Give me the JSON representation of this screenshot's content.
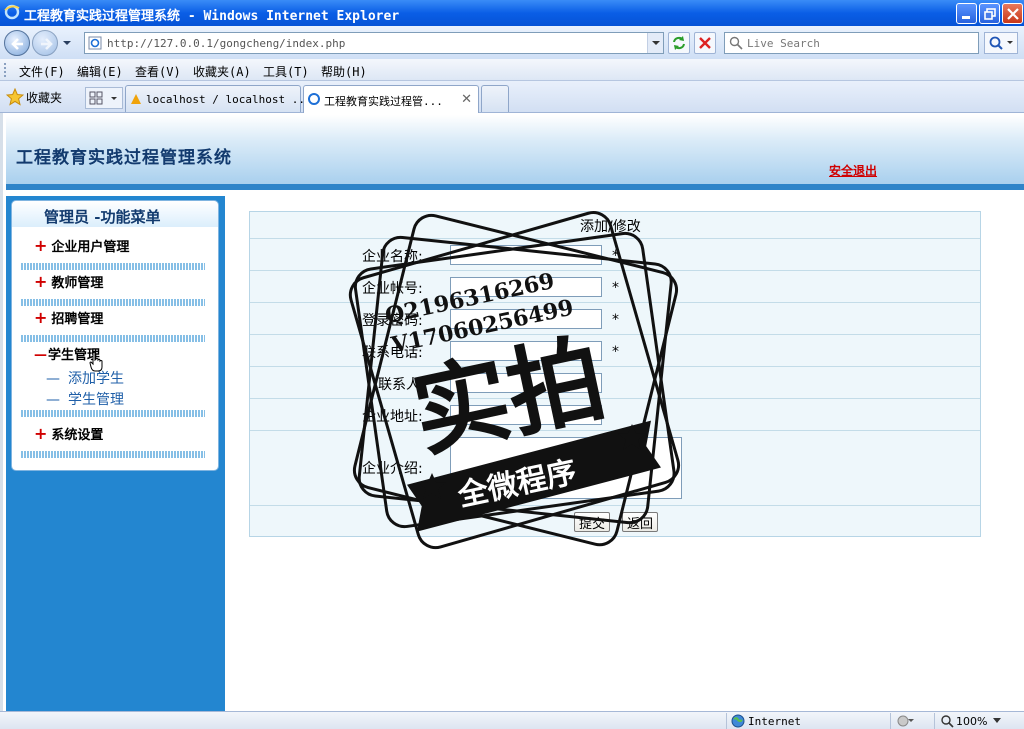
{
  "window": {
    "title": "工程教育实践过程管理系统 - Windows Internet Explorer"
  },
  "address_bar": {
    "url": "http://127.0.0.1/gongcheng/index.php",
    "search_placeholder": "Live Search"
  },
  "menu_bar": {
    "items": [
      "文件(F)",
      "编辑(E)",
      "查看(V)",
      "收藏夹(A)",
      "工具(T)",
      "帮助(H)"
    ]
  },
  "favorites_bar": {
    "favorites_label": "收藏夹",
    "tabs": [
      {
        "label": "localhost / localhost ...",
        "active": false
      },
      {
        "label": "工程教育实践过程管...",
        "active": true
      }
    ]
  },
  "header": {
    "site_title": "工程教育实践过程管理系统",
    "logout_label": "安全退出"
  },
  "sidebar": {
    "heading": "管理员 -功能菜单",
    "groups": [
      {
        "label": "企业用户管理",
        "expanded": false
      },
      {
        "label": "教师管理",
        "expanded": false
      },
      {
        "label": "招聘管理",
        "expanded": false
      },
      {
        "label": "学生管理",
        "expanded": true,
        "children": [
          "添加学生",
          "学生管理"
        ]
      },
      {
        "label": "系统设置",
        "expanded": false
      }
    ]
  },
  "form": {
    "title": "添加/修改",
    "fields": [
      {
        "label": "企业名称:",
        "value": "",
        "required": true,
        "required_mark": "*"
      },
      {
        "label": "企业帐号:",
        "value": "",
        "required": true,
        "required_mark": "*"
      },
      {
        "label": "登录密码:",
        "value": "",
        "required": true,
        "required_mark": "*"
      },
      {
        "label": "联系电话:",
        "value": "",
        "required": true,
        "required_mark": "*"
      },
      {
        "label": "联系人:",
        "value": "",
        "required": false
      },
      {
        "label": "企业地址:",
        "value": "",
        "required": false
      },
      {
        "label": "企业介绍:",
        "value": "",
        "required": false,
        "multiline": true
      }
    ],
    "submit_label": "提交",
    "back_label": "返回"
  },
  "watermark": {
    "line1": "Q2196316269",
    "line2": "V17060256499",
    "main_text": "实拍",
    "banner_text": "全微程序"
  },
  "status_bar": {
    "zone": "Internet",
    "zoom": "100%"
  },
  "colors": {
    "title_bar": "#0a5ee6",
    "sidebar": "#2386d0",
    "logout_red": "#d00000",
    "header_title": "#123a6e"
  }
}
